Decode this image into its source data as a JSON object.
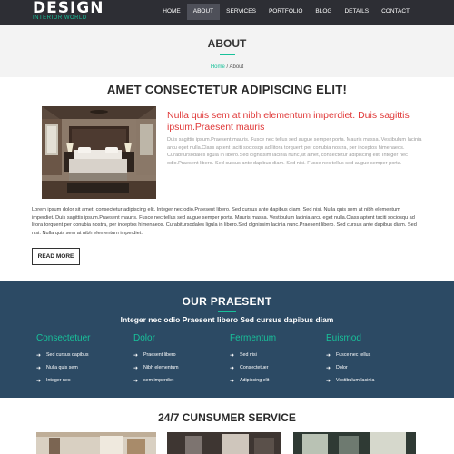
{
  "brand": {
    "title": "DESIGN",
    "tagline": "INTERIOR WORLD",
    "accent": "#18c19a"
  },
  "nav": {
    "items": [
      {
        "label": "HOME",
        "active": false
      },
      {
        "label": "ABOUT",
        "active": true
      },
      {
        "label": "SERVICES",
        "active": false
      },
      {
        "label": "PORTFOLIO",
        "active": false
      },
      {
        "label": "BLOG",
        "active": false
      },
      {
        "label": "DETAILS",
        "active": false
      },
      {
        "label": "CONTACT",
        "active": false
      }
    ]
  },
  "banner": {
    "title": "ABOUT",
    "crumb_home": "Home",
    "crumb_sep": " / ",
    "crumb_current": "About"
  },
  "about": {
    "heading": "AMET CONSECTETUR ADIPISCING ELIT!",
    "subtitle": "Nulla quis sem at nibh elementum imperdiet. Duis sagittis ipsum.Praesent mauris",
    "blurb": "Duis sagittis ipsum.Praesent mauris. Fusce nec tellus sed augue semper porta. Mauris massa. Vestibulum lacinia arcu eget nulla.Class aptent taciti sociosqu ad litora torquent per conubia nostra, per inceptos himenaeos. Curabitursodales ligula in libero.Sed dignissim lacinia nunc,sit amet, consectetur adipiscing elit. Integer nec odio.Praesent libero. Sed cursus ante dapibus diam. Sed nisi. Fusce nec tellus sed augue semper porta.",
    "paragraph": "Lorem ipsum dolor sit amet, consectetur adipiscing elit. Integer nec odio.Praesent libero. Sed cursus ante dapibus diam. Sed nisi. Nulla quis sem at nibh elementum imperdiet. Duis sagittis ipsum.Praesent mauris. Fusce nec tellus sed augue semper porta. Mauris massa. Vestibulum lacinia arcu eget nulla.Class aptent taciti sociosqu ad litora torquent per conubia nostra, per inceptos himenaeos. Curabitursodales ligula in libero.Sed dignissim lacinia nunc.Praesent libero. Sed cursus ante dapibus diam. Sed nisi. Nulla quis sem at nibh elementum imperdiet.",
    "read_more": "READ MORE"
  },
  "praesent": {
    "title": "OUR PRAESENT",
    "subtitle": "Integer nec odio Praesent libero Sed cursus dapibus diam",
    "background": "#2c4a64",
    "columns": [
      {
        "heading": "Consectetuer",
        "items": [
          "Sed cursus dapibus",
          "Nulla quis sem",
          "Integer nec"
        ]
      },
      {
        "heading": "Dolor",
        "items": [
          "Praesent libero",
          "Nibh elementum",
          "sem imperdiet"
        ]
      },
      {
        "heading": "Fermentum",
        "items": [
          "Sed nisi",
          "Consectetuer",
          "Adipiscing elit"
        ]
      },
      {
        "heading": "Euismod",
        "items": [
          "Fusce nec tellus",
          "Dolor",
          "Vestibulum lacinia"
        ]
      }
    ]
  },
  "service": {
    "title": "24/7 CUNSUMER SERVICE"
  }
}
